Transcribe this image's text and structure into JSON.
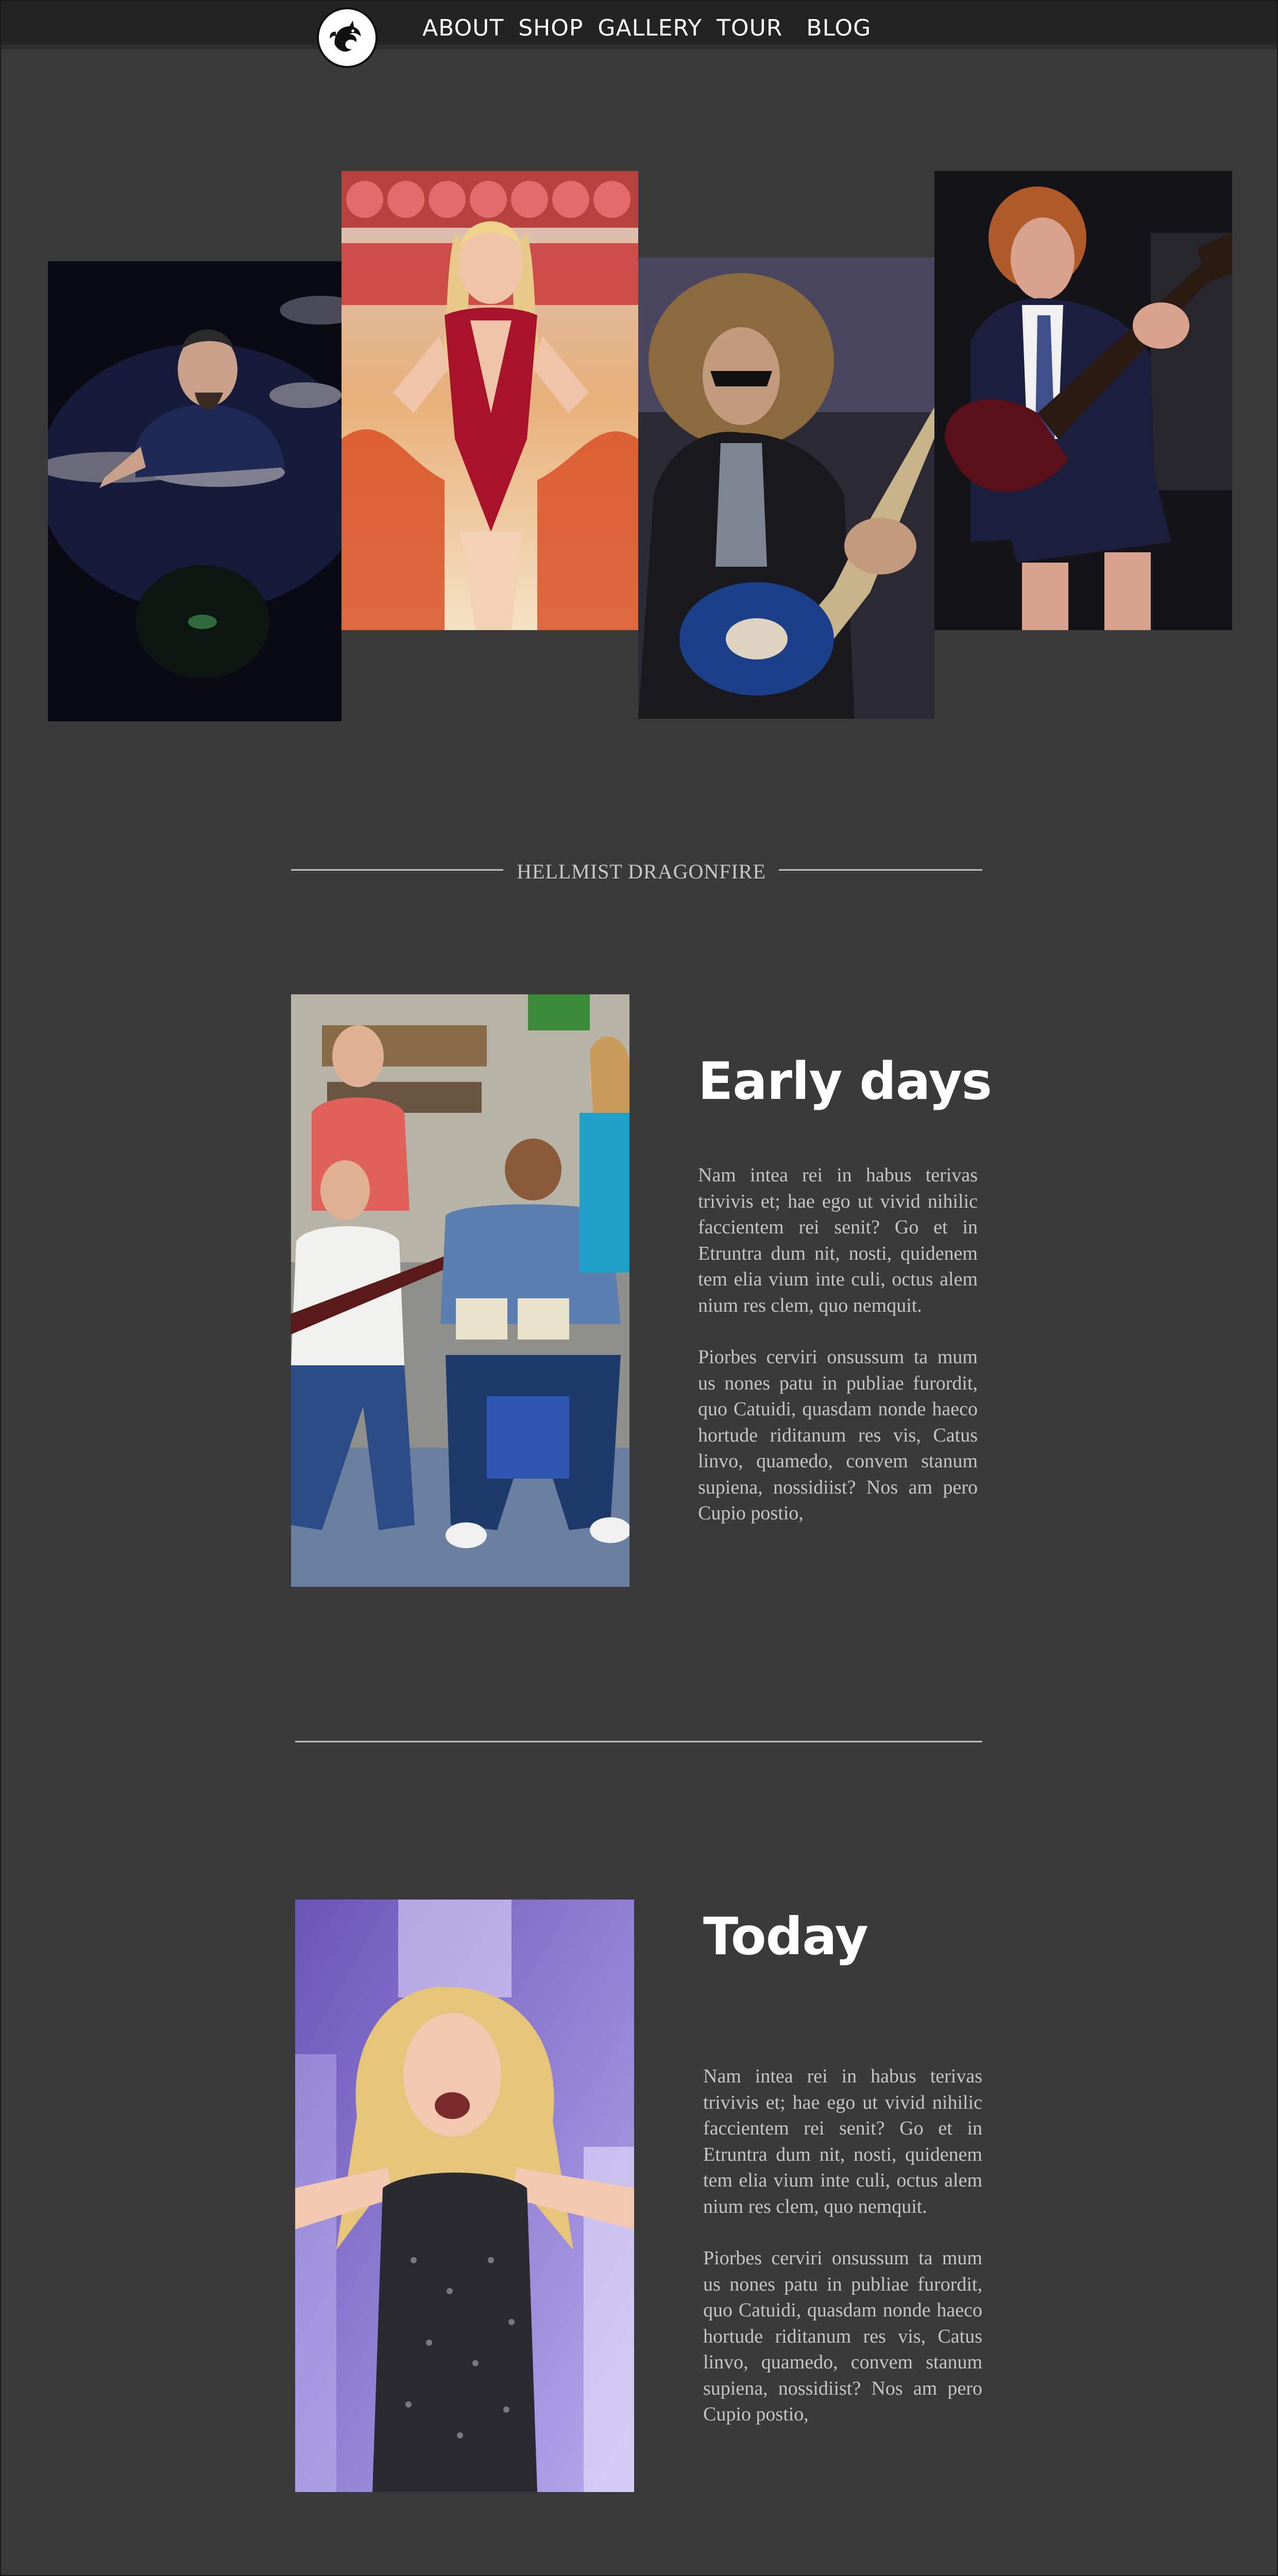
{
  "nav": {
    "logo_icon": "dragon-logo-icon",
    "links": [
      "ABOUT",
      "SHOP",
      "GALLERY",
      "TOUR",
      "BLOG"
    ]
  },
  "hero": {
    "photos": [
      {
        "name": "drummer-photo"
      },
      {
        "name": "vegas-performer-photo"
      },
      {
        "name": "curly-guitarist-photo"
      },
      {
        "name": "schoolboy-guitarist-photo"
      }
    ]
  },
  "divider": {
    "title": "HELLMIST DRAGONFIRE"
  },
  "early": {
    "heading": "Early days",
    "p1": "Nam intea rei in habus terivas trivivis et; hae ego ut vivid nihilic faccientem rei senit? Go et in Etruntra dum nit, nosti, quidenem tem elia vium inte culi, octus alem nium res clem, quo nemquit.",
    "p2": "Piorbes cerviri onsussum ta mum us nones patu in publiae furordit, quo Catuidi, quasdam nonde haeco hortude riditanum res vis, Catus linvo, quamedo, convem stanum supiena, nossidiist? Nos am pero Cupio postio,"
  },
  "today": {
    "heading": "Today",
    "p1": "Nam intea rei in habus terivas trivivis et; hae ego ut vivid nihilic faccientem rei senit? Go et in Etruntra dum nit, nosti, quidenem tem elia vium inte culi, octus alem nium res clem, quo nemquit.",
    "p2": "Piorbes cerviri onsussum ta mum us nones patu in publiae furordit, quo Catuidi, quasdam nonde haeco hortude riditanum res vis, Catus linvo, quamedo, convem stanum supiena, nossidiist? Nos am pero Cupio postio,"
  },
  "colors": {
    "background": "#3a3a3a",
    "nav": "#232323",
    "heading": "#ffffff",
    "body_text": "#c4c4c4",
    "rule": "#bfbfbf"
  }
}
